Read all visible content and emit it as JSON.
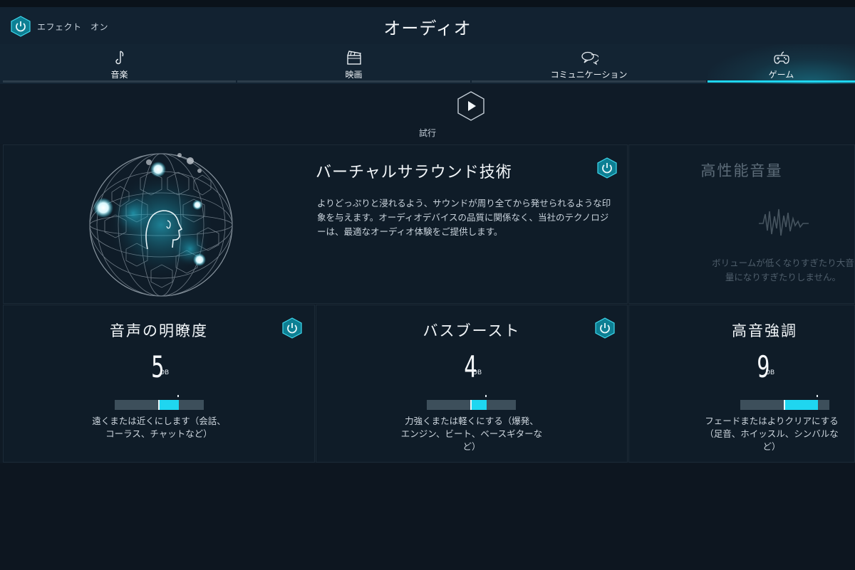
{
  "header": {
    "effect_label": "エフェクト　オン",
    "title": "オーディオ"
  },
  "tabs": [
    {
      "label": "音楽",
      "icon": "music-note-icon"
    },
    {
      "label": "映画",
      "icon": "clapperboard-icon"
    },
    {
      "label": "コミュニケーション",
      "icon": "chat-bubbles-icon"
    },
    {
      "label": "ゲーム",
      "icon": "gamepad-icon",
      "active": true
    }
  ],
  "trial": {
    "label": "試行",
    "icon": "play-icon"
  },
  "surround": {
    "title": "バーチャルサラウンド技術",
    "description": "よりどっぷりと浸れるよう、サウンドが周り全てから発せられるような印象を与えます。オーディオデバイスの品質に関係なく、当社のテクノロジーは、最適なオーディオ体験をご提供します。"
  },
  "volume": {
    "title": "高性能音量",
    "description": "ボリュームが低くなりすぎたり大音量になりすぎたりしません。"
  },
  "clarity": {
    "title": "音声の明瞭度",
    "value": "5",
    "unit": "DB",
    "level": 0.23,
    "desc_line1": "遠くまたは近くにします（会話、",
    "desc_line2": "コーラス、チャットなど）"
  },
  "bass": {
    "title": "バスブースト",
    "value": "4",
    "unit": "DB",
    "level": 0.18,
    "desc_line1": "力強くまたは軽くにする（爆発、",
    "desc_line2": "エンジン、ビート、ベースギターな",
    "desc_line3": "ど）"
  },
  "treble": {
    "title": "高音強調",
    "value": "9",
    "unit": "DB",
    "level": 0.38,
    "desc_line1": "フェードまたはよりクリアにする",
    "desc_line2": "（足音、ホイッスル、シンバルな",
    "desc_line3": "ど）"
  },
  "colors": {
    "accent": "#1fd6f0",
    "background": "#0f1a25",
    "panel": "#0f1c28"
  }
}
